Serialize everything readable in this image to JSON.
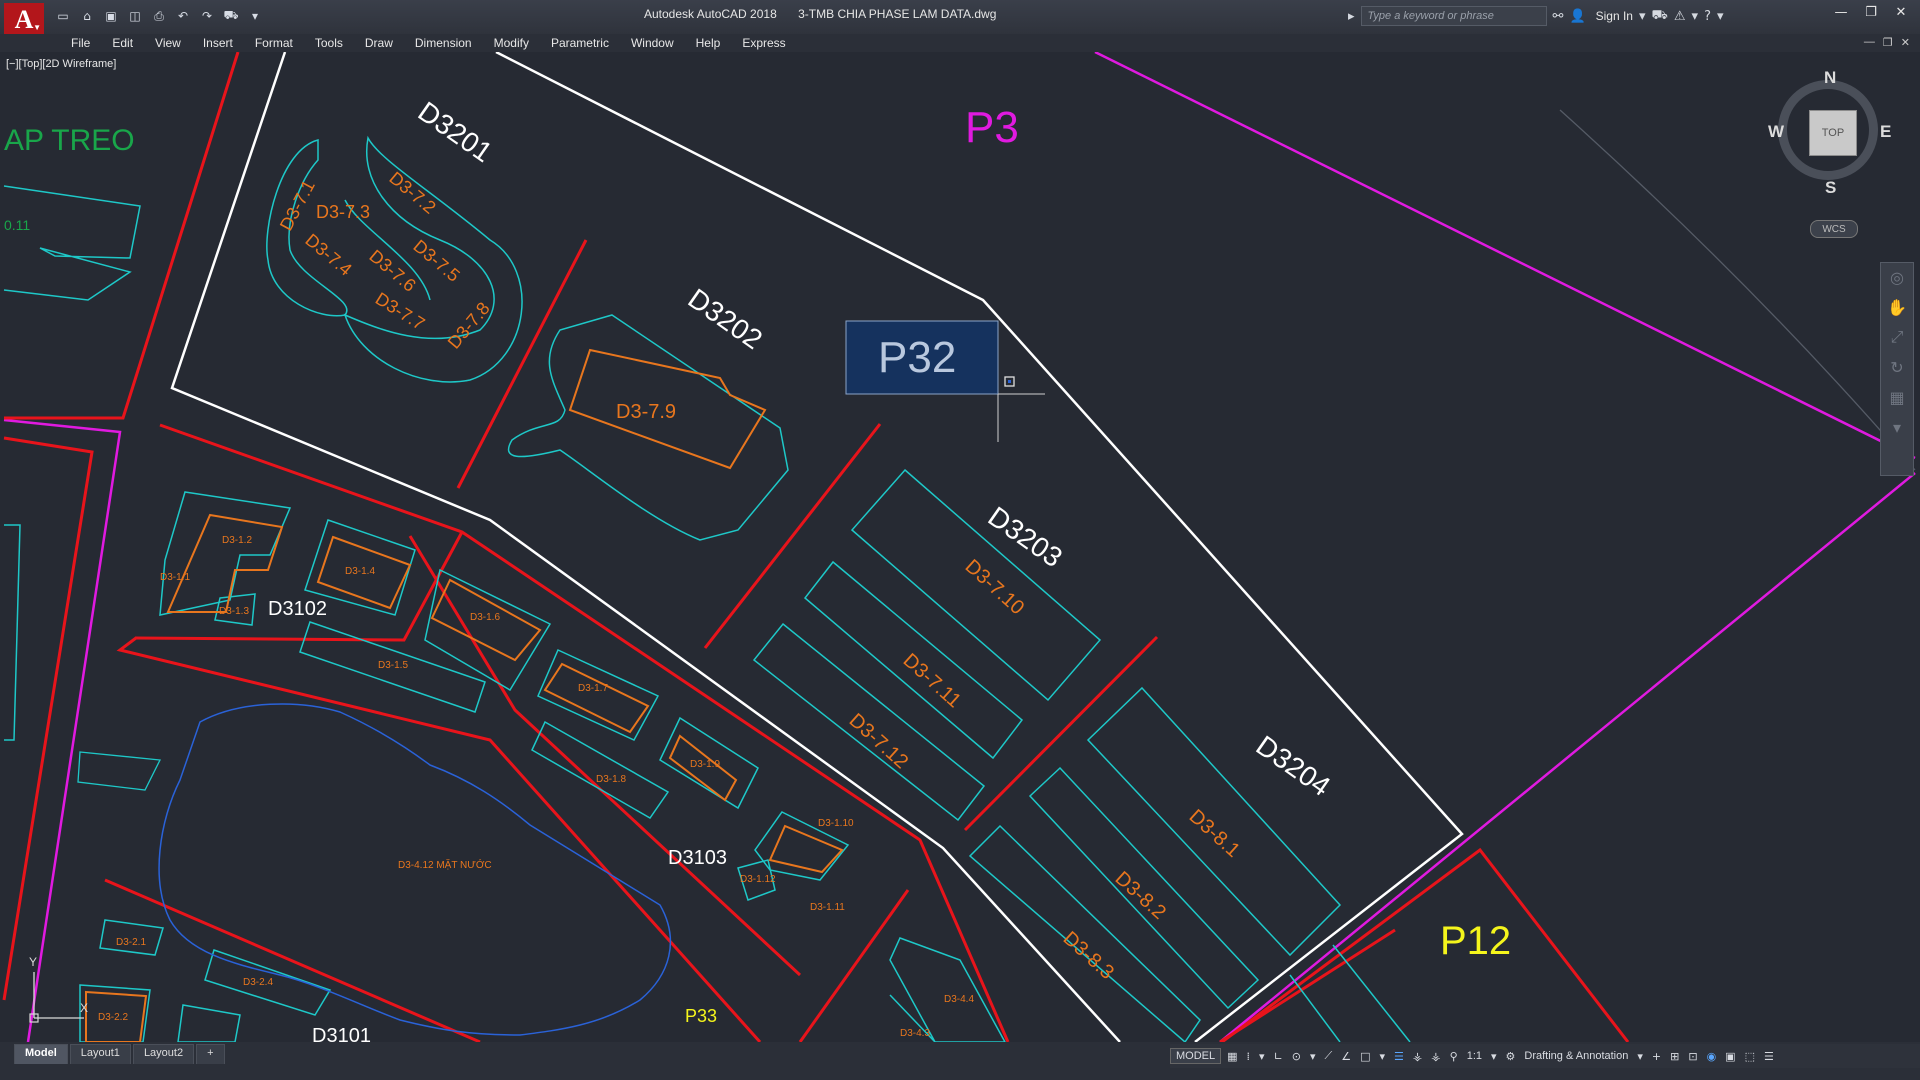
{
  "app": {
    "logo_letter": "A",
    "title": "Autodesk AutoCAD 2018",
    "filename": "3-TMB CHIA PHASE LAM DATA.dwg"
  },
  "quick_access": [
    "new-icon",
    "open-icon",
    "save-icon",
    "saveas-icon",
    "print-icon",
    "undo-icon",
    "redo-icon",
    "cart-icon"
  ],
  "search": {
    "placeholder": "Type a keyword or phrase"
  },
  "account": {
    "sign_in": "Sign In"
  },
  "menu": [
    "File",
    "Edit",
    "View",
    "Insert",
    "Format",
    "Tools",
    "Draw",
    "Dimension",
    "Modify",
    "Parametric",
    "Window",
    "Help",
    "Express"
  ],
  "viewport_label": "[−][Top][2D Wireframe]",
  "viewcube": {
    "face": "TOP",
    "north": "N",
    "south": "S",
    "east": "E",
    "west": "W",
    "wcs": "WCS"
  },
  "drawing": {
    "title_left": "AP TREO",
    "left_small": "0.11",
    "zone_labels": [
      "P3",
      "P32",
      "P12",
      "P33"
    ],
    "block_labels": [
      "D3201",
      "D3202",
      "D3203",
      "D3204",
      "D3102",
      "D3103",
      "D3101"
    ],
    "lot_labels": [
      "D3-7.1",
      "D3-7.2",
      "D3-7.3",
      "D3-7.4",
      "D3-7.5",
      "D3-7.6",
      "D3-7.7",
      "D3-7.8",
      "D3-7.9",
      "D3-7.10",
      "D3-7.11",
      "D3-7.12",
      "D3-8.1",
      "D3-8.2",
      "D3-8.3",
      "D3-1.1",
      "D3-1.2",
      "D3-1.3",
      "D3-1.4",
      "D3-1.5",
      "D3-1.6",
      "D3-1.7",
      "D3-1.8",
      "D3-1.9",
      "D3-1.10",
      "D3-1.11",
      "D3-1.12",
      "D3-2.1",
      "D3-2.2",
      "D3-2.4",
      "D3-4.4",
      "D3-4.3",
      "D3-4.12 MẶT NƯỚC"
    ],
    "colors": {
      "bg": "#262a33",
      "white": "#ffffff",
      "red": "#e8141b",
      "magenta": "#e01ae0",
      "cyan": "#1ec8c8",
      "orange": "#e8761e",
      "blue": "#2a62d8",
      "yellow": "#f5f51c",
      "green": "#19a64a"
    }
  },
  "tabs": {
    "model": "Model",
    "layout1": "Layout1",
    "layout2": "Layout2",
    "add": "+"
  },
  "status": {
    "model": "MODEL",
    "scale": "1:1",
    "workspace": "Drafting & Annotation"
  }
}
